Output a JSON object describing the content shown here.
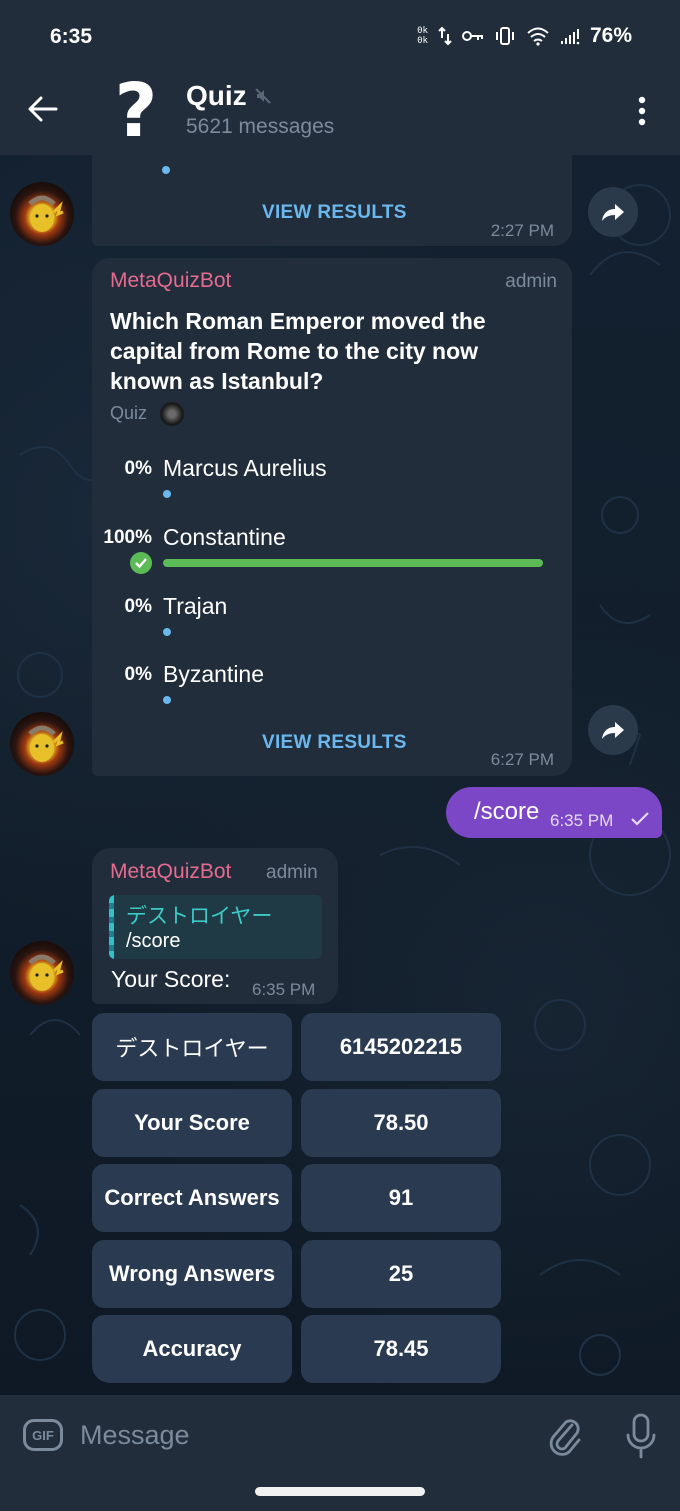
{
  "status_bar": {
    "time": "6:35",
    "net_up": "0k",
    "net_down": "0k",
    "icons": [
      "data-transfer-icon",
      "vpn-key-icon",
      "vibrate-icon",
      "wifi-icon",
      "signal-icon"
    ],
    "battery": "76%"
  },
  "header": {
    "title": "Quiz",
    "subtitle": "5621 messages",
    "avatar_glyph": "?",
    "muted": true
  },
  "messages": {
    "prev_poll": {
      "view_results": "VIEW RESULTS",
      "time": "2:27 PM"
    },
    "poll": {
      "sender": "MetaQuizBot",
      "role": "admin",
      "question": "Which Roman Emperor moved the capital from Rome to the city now known as Istanbul?",
      "type_label": "Quiz",
      "options": [
        {
          "percent": "0%",
          "text": "Marcus Aurelius",
          "value": 0,
          "correct": false
        },
        {
          "percent": "100%",
          "text": "Constantine",
          "value": 100,
          "correct": true
        },
        {
          "percent": "0%",
          "text": "Trajan",
          "value": 0,
          "correct": false
        },
        {
          "percent": "0%",
          "text": "Byzantine",
          "value": 0,
          "correct": false
        }
      ],
      "view_results": "VIEW RESULTS",
      "time": "6:27 PM"
    },
    "outgoing": {
      "text": "/score",
      "time": "6:35 PM",
      "status": "sent"
    },
    "score_reply": {
      "sender": "MetaQuizBot",
      "role": "admin",
      "reply_to_name": "デストロイヤー",
      "reply_to_text": "/score",
      "text": "Your Score:",
      "time": "6:35 PM",
      "keyboard": [
        [
          "デストロイヤー",
          "6145202215"
        ],
        [
          "Your Score",
          "78.50"
        ],
        [
          "Correct Answers",
          "91"
        ],
        [
          "Wrong Answers",
          "25"
        ],
        [
          "Accuracy",
          "78.45"
        ]
      ]
    }
  },
  "composer": {
    "gif_label": "GIF",
    "placeholder": "Message"
  },
  "colors": {
    "accent_link": "#6ab8ee",
    "sender_name": "#e56b8f",
    "correct": "#5cbb56",
    "outgoing_bubble": "#7c47c6",
    "bubble": "#212d3b"
  }
}
